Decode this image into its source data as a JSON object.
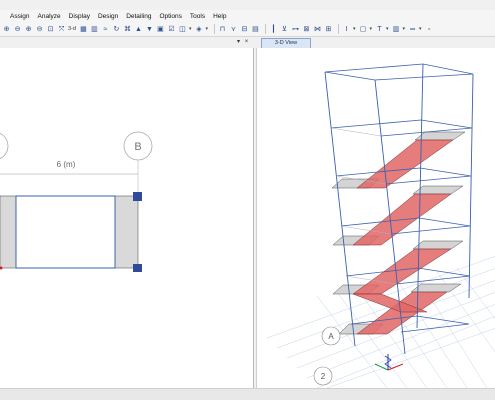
{
  "menu": {
    "items": [
      "Assign",
      "Analyze",
      "Display",
      "Design",
      "Detailing",
      "Options",
      "Tools",
      "Help"
    ]
  },
  "toolbar": {
    "view_3d_label": "3-d",
    "icons": [
      "zoom-in-icon",
      "zoom-out-icon",
      "zoom-window-icon",
      "zoom-previous-icon",
      "zoom-fit-icon",
      "pan-icon",
      "view-3d-icon",
      "plan-view-icon",
      "elevation-view-icon",
      "rubber-band-icon",
      "rotate-icon",
      "move-up-icon",
      "move-down-icon",
      "display-options-icon",
      "set-building-view-icon",
      "object-shrink-icon",
      "frame-icon",
      "brace-icon",
      "beam-icon",
      "wall-icon",
      "slab-icon",
      "column-icon",
      "joint-icon",
      "draw-line-icon",
      "draw-area-icon",
      "text-icon",
      "grid-icon",
      "section-icon",
      "dimension-icon",
      "more-icon"
    ]
  },
  "tabs": {
    "left_pin": "▾",
    "left_close": "×",
    "view_3d": "3-D View"
  },
  "plan_view": {
    "grid_bubble_a": "",
    "grid_bubble_b": "B",
    "dimension_label": "6 (m)"
  },
  "view_3d": {
    "grid_label_a": "A",
    "grid_label_2": "2",
    "stories": 5
  },
  "colors": {
    "stair_fill": "#e06666",
    "slab_fill": "#d4d4d4",
    "frame_line": "#3a5fb0",
    "column_gray": "#d9d9d9",
    "joint_blue": "#2f4a9a",
    "grid_blue": "#9db5d8"
  }
}
